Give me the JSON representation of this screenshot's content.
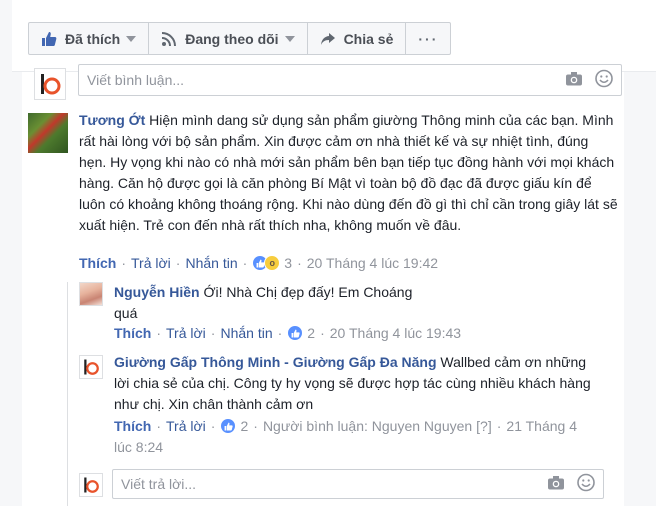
{
  "actions": {
    "like_label": "Đã thích",
    "follow_label": "Đang theo dõi",
    "share_label": "Chia sẻ",
    "more_label": "···"
  },
  "top_comment_box": {
    "placeholder": "Viết bình luận..."
  },
  "comment_main": {
    "author": "Tương Ớt",
    "text": "Hiện mình dang sử dụng sản phẩm giường Thông minh của các bạn. Mình rất hài lòng với bộ sản phẩm. Xin được cảm ơn nhà thiết kế và sự nhiệt tình, đúng hẹn. Hy vọng khi nào có nhà mới sản phẩm bên bạn tiếp tục đồng hành với mọi khách hàng. Căn hộ được gọi là căn phòng Bí Mật vì toàn bộ đồ đạc đã được giấu kín để luôn có khoảng không thoáng rộng. Khi nào dùng đến đồ gì thì chỉ cần trong giây lát sẽ xuất hiện. Trẻ con đến nhà rất thích nha, không muốn về đâu.",
    "like": "Thích",
    "reply": "Trả lời",
    "message": "Nhắn tin",
    "reaction_count": "3",
    "time": "20 Tháng 4 lúc 19:42"
  },
  "reply1": {
    "author": "Nguyễn Hiền",
    "text": "Ới! Nhà Chị đẹp đấy! Em Choáng quá",
    "like": "Thích",
    "reply": "Trả lời",
    "message": "Nhắn tin",
    "reaction_count": "2",
    "time": "20 Tháng 4 lúc 19:43"
  },
  "reply2": {
    "author": "Giường Gấp Thông Minh - Giường Gấp Đa Năng",
    "text": "Wallbed cảm ơn những lời chia sẻ của chị. Công ty hy vọng sẽ được hợp tác cùng nhiều khách hàng như chị. Xin chân thành cảm ơn",
    "like": "Thích",
    "reply": "Trả lời",
    "reaction_count": "2",
    "commenter": "Người bình luận: Nguyen Nguyen",
    "help": "[?]",
    "time_line1": "21 Tháng 4",
    "time_line2": "lúc 8:24"
  },
  "reply_box": {
    "placeholder": "Viết trả lời..."
  },
  "colors": {
    "link": "#365899",
    "like_blue": "#4267b2",
    "meta_gray": "#90949c",
    "brand_orange": "#e8532b"
  }
}
